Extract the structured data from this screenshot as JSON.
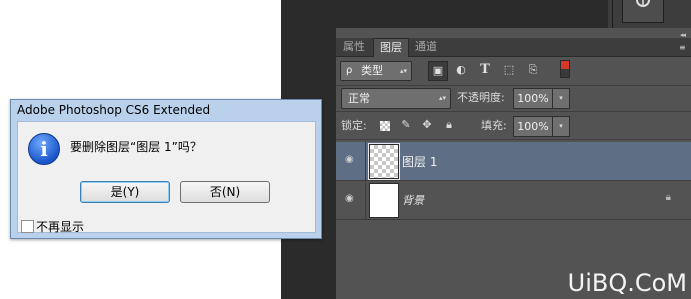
{
  "dialog": {
    "title": "Adobe Photoshop CS6 Extended",
    "message": "要删除图层“图层 1”吗？",
    "yes_label": "是(Y)",
    "no_label": "否(N)",
    "dont_show_label": "不再显示",
    "dont_show_checked": false,
    "icon": "info-icon"
  },
  "panel": {
    "collapse_glyph": "◂◂",
    "close_glyph": "×",
    "tabs": [
      {
        "label": "属性",
        "active": false
      },
      {
        "label": "图层",
        "active": true
      },
      {
        "label": "通道",
        "active": false
      }
    ],
    "tab_menu_glyph": "≡",
    "filter": {
      "kind_label": "类型",
      "search_glyph": "ρ",
      "buttons": [
        {
          "icon": "image-filter-icon",
          "glyph": "▣"
        },
        {
          "icon": "adjustment-filter-icon",
          "glyph": "◐"
        },
        {
          "icon": "type-filter-icon",
          "glyph": "T"
        },
        {
          "icon": "shape-filter-icon",
          "glyph": "⬚"
        },
        {
          "icon": "smart-object-filter-icon",
          "glyph": "⎘"
        }
      ]
    },
    "blend_mode": "正常",
    "opacity_label": "不透明度:",
    "opacity_value": "100%",
    "lock_label": "锁定:",
    "fill_label": "填充:",
    "fill_value": "100%",
    "layers": [
      {
        "name": "图层 1",
        "selected": true,
        "visible": true,
        "locked": false
      },
      {
        "name": "背景",
        "selected": false,
        "visible": true,
        "locked": true
      }
    ]
  },
  "watermark": "UiBQ.CoM",
  "colors": {
    "workspace": "#2b2b2b",
    "panel": "#535353",
    "selected_layer": "#5e6e85",
    "dialog_frame": "#b9d1ea"
  }
}
